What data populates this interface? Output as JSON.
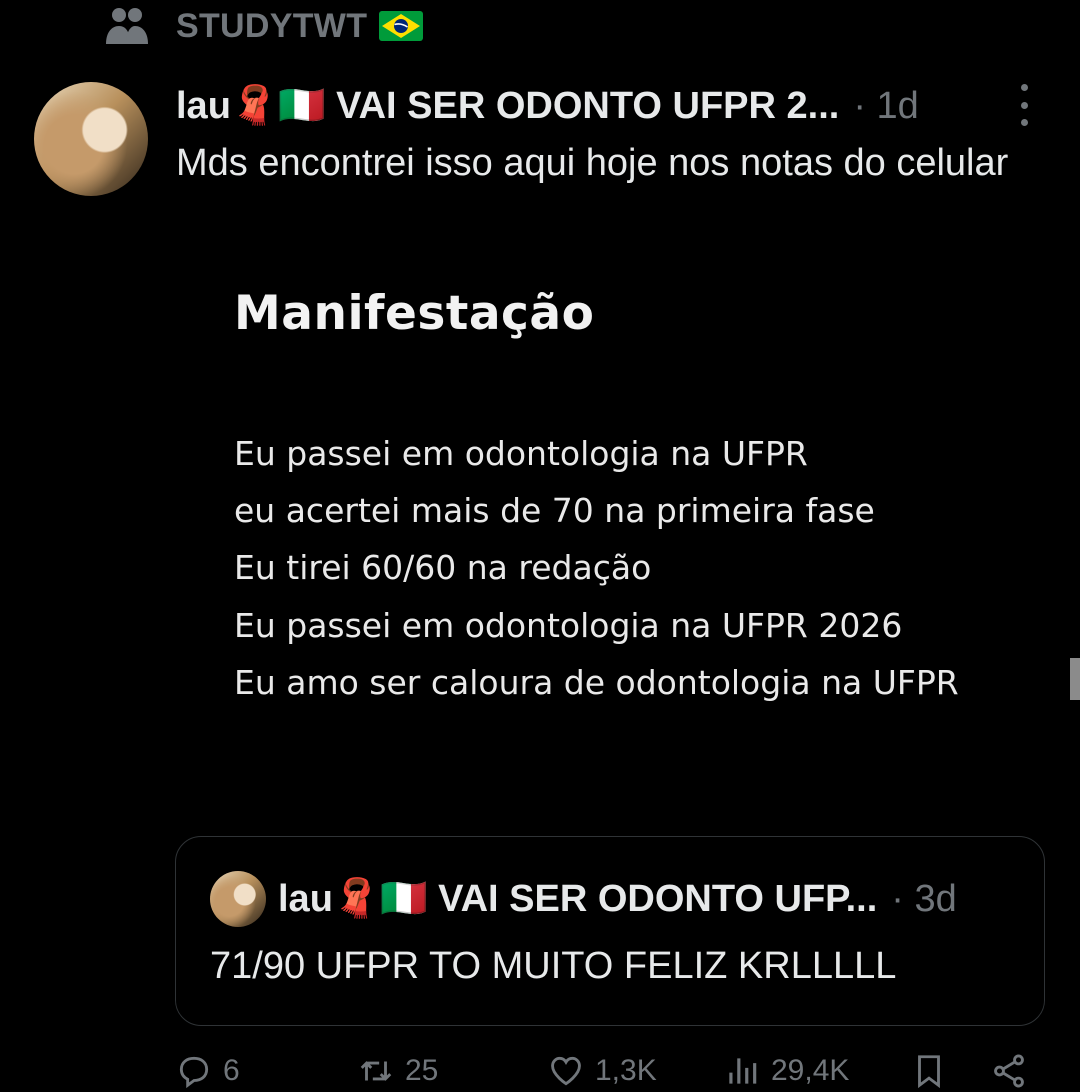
{
  "community": {
    "label": "STUDYTWT",
    "icon": "community-icon",
    "flag": "brazil-flag"
  },
  "tweet": {
    "author": "lau🧣🇮🇹 VAI SER ODONTO UFPR 2...",
    "time": "· 1d",
    "text": "Mds encontrei isso aqui hoje nos notas do celular"
  },
  "note": {
    "title": "Manifestação",
    "lines": [
      "Eu passei em odontologia na UFPR",
      "eu acertei mais de 70 na primeira fase",
      "Eu tirei 60/60 na redação",
      "Eu passei em odontologia na UFPR 2026",
      "Eu amo ser caloura de odontologia na UFPR"
    ]
  },
  "quote": {
    "author": "lau🧣🇮🇹 VAI SER ODONTO UFP...",
    "time": "· 3d",
    "text": "71/90 UFPR TO MUITO FELIZ KRLLLLL"
  },
  "actions": {
    "replies": "6",
    "reposts": "25",
    "likes": "1,3K",
    "views": "29,4K"
  },
  "colors": {
    "background": "#000000",
    "text": "#e7e9ea",
    "secondary": "#71767b",
    "border": "#2f3336"
  }
}
